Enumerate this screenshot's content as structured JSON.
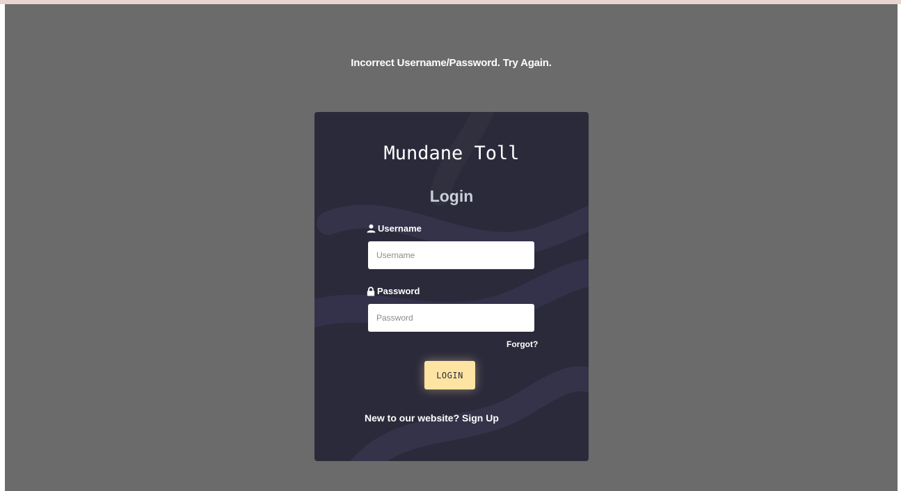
{
  "page": {
    "error_message": "Incorrect Username/Password. Try Again."
  },
  "card": {
    "brand": "Mundane Toll",
    "heading": "Login",
    "username": {
      "label": "Username",
      "placeholder": "Username",
      "icon": "user-icon"
    },
    "password": {
      "label": "Password",
      "placeholder": "Password",
      "icon": "lock-icon"
    },
    "forgot_link": "Forgot?",
    "login_button": "LOGIN",
    "signup_prompt": "New to our website?",
    "signup_link": "Sign Up"
  },
  "colors": {
    "backdrop": "#6b6b6b",
    "card": "#2b2a3b",
    "button": "#fde4a3",
    "heading": "#c9cfd6"
  }
}
